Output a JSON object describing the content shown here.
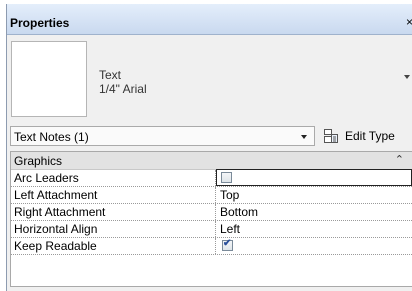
{
  "panel": {
    "title": "Properties",
    "close_glyph": "×"
  },
  "type_selector": {
    "name": "Text",
    "subtitle": "1/4\" Arial"
  },
  "instance_filter": {
    "selected": "Text Notes (1)"
  },
  "edit_type": {
    "label": "Edit Type",
    "icon": "edit-type-icon"
  },
  "groups": [
    {
      "label": "Graphics",
      "collapse_glyph": "⌃",
      "properties": [
        {
          "name": "Arc Leaders",
          "value": "",
          "kind": "checkbox",
          "checked": false
        },
        {
          "name": "Left Attachment",
          "value": "Top",
          "kind": "text"
        },
        {
          "name": "Right Attachment",
          "value": "Bottom",
          "kind": "text"
        },
        {
          "name": "Horizontal Align",
          "value": "Left",
          "kind": "text"
        },
        {
          "name": "Keep Readable",
          "value": "",
          "kind": "checkbox",
          "checked": true
        }
      ]
    }
  ],
  "colors": {
    "titlebar": "#c9d9ef",
    "group_header": "#e2e2e2",
    "checkmark": "#2a4f9a"
  }
}
